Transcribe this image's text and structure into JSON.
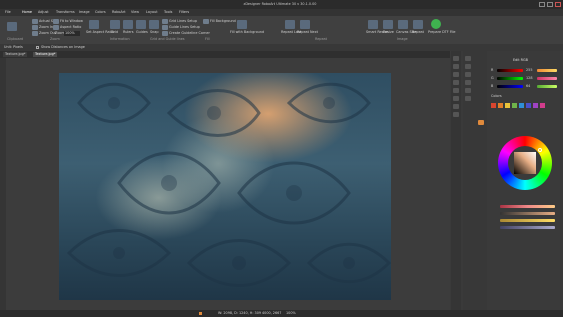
{
  "app": {
    "title": "zDesigner RoboArt Ultimate 30 v 30.1.0.00",
    "menu": [
      "File",
      "Home",
      "Adjust",
      "Transforms",
      "Image",
      "Colors",
      "RoboArt",
      "View",
      "Layout",
      "Tools",
      "Filters"
    ]
  },
  "ribbon": {
    "clipboard": {
      "label": "Clipboard"
    },
    "zoom_group": {
      "items": [
        "Actual Size",
        "Zoom In",
        "Zoom Out",
        "Fit to Window",
        "Aspect Ratio",
        "Zoom"
      ],
      "zoom_value": "100%",
      "label": "Zoom"
    },
    "info_group": {
      "items": [
        "Set Aspect Ratio",
        "Info"
      ],
      "label": "Information"
    },
    "grid_group": {
      "items": [
        "Grid",
        "Rulers",
        "Guides",
        "Snap"
      ],
      "label": "Grid and Guide lines"
    },
    "snap_group": {
      "items": [
        "Grid Lines Setup",
        "Guide Lines Setup",
        "Create Guideline Corner"
      ]
    },
    "bg_group": {
      "items": [
        "Fill Background",
        "Fill with Background"
      ],
      "label": "Fill"
    },
    "repeat_group": {
      "items": [
        "Repeat Last",
        "Repeat Next"
      ],
      "label": "Repeat"
    },
    "image_group": {
      "items": [
        "Smart Resize",
        "Resize",
        "Canvas Size",
        "Repeat"
      ],
      "label": "Image"
    },
    "prepare_label": "Prepare DTF File"
  },
  "options": {
    "units_label": "Unit: Pixels",
    "show_dist_label": "Show Distances on Image"
  },
  "tabs": [
    "Texture.jpg*",
    "Texture.jpg*"
  ],
  "document": {
    "header": "Texture.jpg * (1192, 800) (50.99) @ 100% (50.99) • 7 (Index)"
  },
  "status": {
    "coords": "W: 2098, D: 1240, H: 309",
    "size": "4000, 2667",
    "zoom": "100%"
  },
  "panel": {
    "title": "Edit RGB",
    "labels": [
      "R",
      "G",
      "B"
    ],
    "values": [
      "255",
      "128",
      "64"
    ],
    "section": "Colors",
    "swatch_colors": [
      "#d8452f",
      "#e07d2a",
      "#e9c23a",
      "#6fb34a",
      "#2f8fd6",
      "#4b4fc9",
      "#9f43c3",
      "#d23c8c"
    ],
    "wheel_colors": [
      "#ff0000",
      "#ffff00",
      "#00ff00",
      "#00ffff",
      "#0000ff",
      "#ff00ff",
      "#ff0000"
    ]
  }
}
